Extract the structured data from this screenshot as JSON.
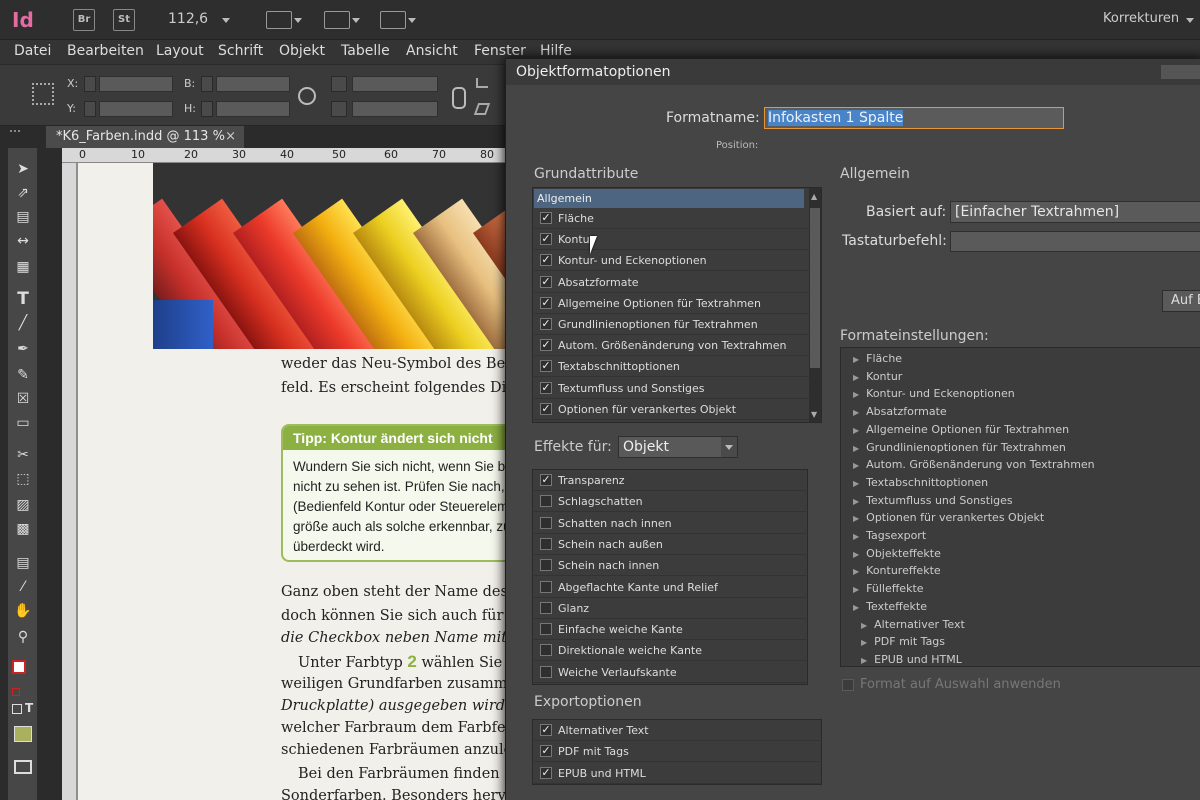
{
  "app": {
    "logo": "Id",
    "bridge_label": "Br",
    "stock_label": "St",
    "zoom_value": "112,6",
    "workspace": "Korrekturen"
  },
  "menu": [
    "Datei",
    "Bearbeiten",
    "Layout",
    "Schrift",
    "Objekt",
    "Tabelle",
    "Ansicht",
    "Fenster",
    "Hilfe"
  ],
  "control": {
    "x_label": "X:",
    "y_label": "Y:",
    "b_label": "B:",
    "h_label": "H:"
  },
  "doc_tab": {
    "title": "*K6_Farben.indd @ 113 %",
    "close": "×"
  },
  "ruler": [
    "0",
    "10",
    "20",
    "30",
    "40",
    "50",
    "60",
    "70",
    "80"
  ],
  "page_text": {
    "p1": [
      "weder das Neu-Symbol des Bedien",
      "feld. Es erscheint folgendes Dialog"
    ],
    "tip_title": "Tipp: Kontur ändert sich nicht",
    "tip_lines": [
      "Wundern Sie sich nicht, wenn Sie bei",
      "nicht zu sehen ist. Prüfen Sie nach, a",
      "(Bedienfeld Kontur oder Steuereleme",
      "größe auch als solche erkennbar, zum",
      "überdeckt wird."
    ],
    "p2": [
      "Ganz oben steht der Name des Fa",
      "doch können Sie sich auch für ein",
      "die Checkbox neben Name mit Farb"
    ],
    "p3_prefix": "Unter Farbtyp",
    "p3_num": "2",
    "p3_suffix": "wählen Sie Pr",
    "p3": [
      "weiligen Grundfarben zusammen",
      "Druckplatte) ausgegeben wird. U",
      "welcher Farbraum dem Farbfeld",
      "schiedenen Farbräumen anzulege"
    ],
    "p4": [
      "Bei den Farbräumen finden Sie",
      "Sonderfarben. Besonders hervorz"
    ]
  },
  "dialog": {
    "title": "Objektformatoptionen",
    "format_name_label": "Formatname:",
    "format_name_value": "Infokasten 1 Spalte",
    "position_label": "Position:",
    "grund_header": "Grundattribute",
    "grund_selected": "Allgemein",
    "grund_items": [
      "Fläche",
      "Kontur",
      "Kontur- und Eckenoptionen",
      "Absatzformate",
      "Allgemeine Optionen für Textrahmen",
      "Grundlinienoptionen für Textrahmen",
      "Autom. Größenänderung von Textrahmen",
      "Textabschnittoptionen",
      "Textumfluss und Sonstiges",
      "Optionen für verankertes Objekt"
    ],
    "effects_label": "Effekte für:",
    "effects_value": "Objekt",
    "effect_items": [
      "Transparenz",
      "Schlagschatten",
      "Schatten nach innen",
      "Schein nach außen",
      "Schein nach innen",
      "Abgeflachte Kante und Relief",
      "Glanz",
      "Einfache weiche Kante",
      "Direktionale weiche Kante",
      "Weiche Verlaufskante"
    ],
    "export_header": "Exportoptionen",
    "export_items": [
      "Alternativer Text",
      "PDF mit Tags",
      "EPUB und HTML"
    ],
    "allgemein_header": "Allgemein",
    "based_on_label": "Basiert auf:",
    "based_on_value": "[Einfacher Textrahmen]",
    "shortcut_label": "Tastaturbefehl:",
    "reset_button": "Auf B",
    "settings_header": "Formateinstellungen:",
    "settings_items": [
      "Fläche",
      "Kontur",
      "Kontur- und Eckenoptionen",
      "Absatzformate",
      "Allgemeine Optionen für Textrahmen",
      "Grundlinienoptionen für Textrahmen",
      "Autom. Größenänderung von Textrahmen",
      "Textabschnittoptionen",
      "Textumfluss und Sonstiges",
      "Optionen für verankertes Objekt",
      "Tagsexport",
      "Objekteffekte",
      "Kontureffekte",
      "Fülleffekte",
      "Texteffekte",
      "Alternativer Text",
      "PDF mit Tags",
      "EPUB und HTML"
    ],
    "apply_label": "Format auf Auswahl anwenden"
  },
  "colors": {
    "tip_green": "#8db043",
    "accent_blue": "#4a84c8",
    "logo_pink": "#e46ba4"
  }
}
